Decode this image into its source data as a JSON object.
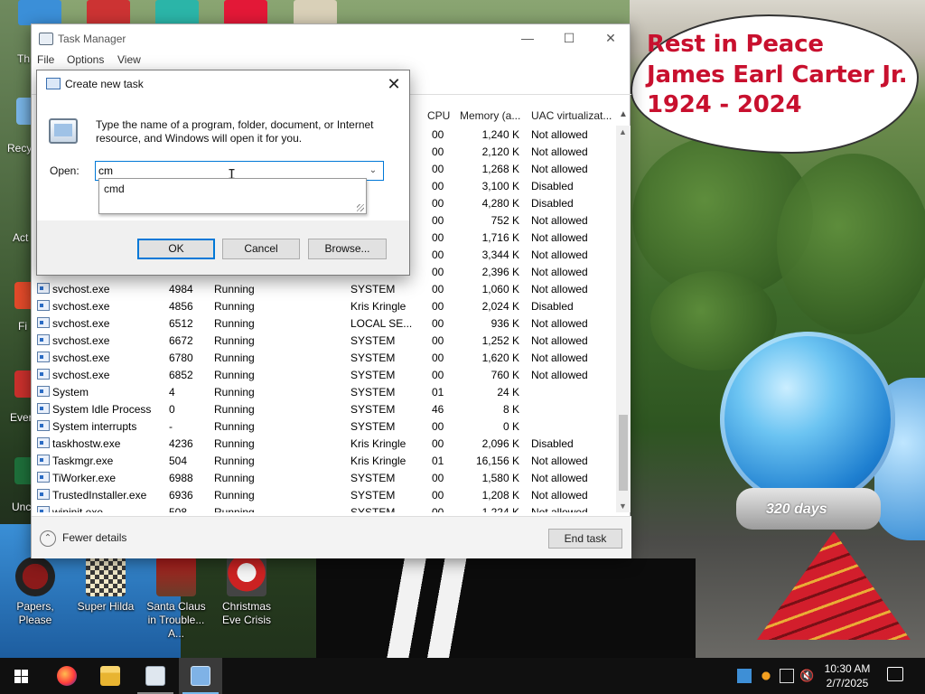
{
  "desktop": {
    "icons": [
      {
        "label": "Papers, Please",
        "name": "desktop-icon-papers-please"
      },
      {
        "label": "Super Hilda",
        "name": "desktop-icon-super-hilda"
      },
      {
        "label": "Santa Claus in Trouble... A...",
        "name": "desktop-icon-santa-claus"
      },
      {
        "label": "Christmas Eve Crisis",
        "name": "desktop-icon-christmas-eve-crisis"
      }
    ],
    "edge_labels": [
      "Th",
      "Recy",
      "Act",
      "Fi",
      "Ever",
      "Unc"
    ],
    "wallpaper_text": [
      "Rest in Peace",
      "James Earl Carter Jr.",
      "1924 - 2024"
    ],
    "globe_text": "320 days"
  },
  "task_manager": {
    "title": "Task Manager",
    "menu": [
      "File",
      "Options",
      "View"
    ],
    "columns": {
      "cpu": "CPU",
      "memory": "Memory (a...",
      "uac": "UAC virtualizat..."
    },
    "rows": [
      {
        "cpu": "00",
        "mem": "1,240 K",
        "uac": "Not allowed"
      },
      {
        "cpu": "00",
        "mem": "2,120 K",
        "uac": "Not allowed"
      },
      {
        "cpu": "00",
        "mem": "1,268 K",
        "uac": "Not allowed"
      },
      {
        "cpu": "00",
        "mem": "3,100 K",
        "uac": "Disabled"
      },
      {
        "cpu": "00",
        "mem": "4,280 K",
        "uac": "Disabled"
      },
      {
        "cpu": "00",
        "mem": "752 K",
        "uac": "Not allowed"
      },
      {
        "cpu": "00",
        "mem": "1,716 K",
        "uac": "Not allowed"
      },
      {
        "cpu": "00",
        "mem": "3,344 K",
        "uac": "Not allowed"
      },
      {
        "cpu": "00",
        "mem": "2,396 K",
        "uac": "Not allowed"
      },
      {
        "name": "svchost.exe",
        "pid": "4984",
        "status": "Running",
        "user": "SYSTEM",
        "cpu": "00",
        "mem": "1,060 K",
        "uac": "Not allowed"
      },
      {
        "name": "svchost.exe",
        "pid": "4856",
        "status": "Running",
        "user": "Kris Kringle",
        "cpu": "00",
        "mem": "2,024 K",
        "uac": "Disabled"
      },
      {
        "name": "svchost.exe",
        "pid": "6512",
        "status": "Running",
        "user": "LOCAL SE...",
        "cpu": "00",
        "mem": "936 K",
        "uac": "Not allowed"
      },
      {
        "name": "svchost.exe",
        "pid": "6672",
        "status": "Running",
        "user": "SYSTEM",
        "cpu": "00",
        "mem": "1,252 K",
        "uac": "Not allowed"
      },
      {
        "name": "svchost.exe",
        "pid": "6780",
        "status": "Running",
        "user": "SYSTEM",
        "cpu": "00",
        "mem": "1,620 K",
        "uac": "Not allowed"
      },
      {
        "name": "svchost.exe",
        "pid": "6852",
        "status": "Running",
        "user": "SYSTEM",
        "cpu": "00",
        "mem": "760 K",
        "uac": "Not allowed"
      },
      {
        "name": "System",
        "pid": "4",
        "status": "Running",
        "user": "SYSTEM",
        "cpu": "01",
        "mem": "24 K",
        "uac": ""
      },
      {
        "name": "System Idle Process",
        "pid": "0",
        "status": "Running",
        "user": "SYSTEM",
        "cpu": "46",
        "mem": "8 K",
        "uac": ""
      },
      {
        "name": "System interrupts",
        "pid": "-",
        "status": "Running",
        "user": "SYSTEM",
        "cpu": "00",
        "mem": "0 K",
        "uac": ""
      },
      {
        "name": "taskhostw.exe",
        "pid": "4236",
        "status": "Running",
        "user": "Kris Kringle",
        "cpu": "00",
        "mem": "2,096 K",
        "uac": "Disabled"
      },
      {
        "name": "Taskmgr.exe",
        "pid": "504",
        "status": "Running",
        "user": "Kris Kringle",
        "cpu": "01",
        "mem": "16,156 K",
        "uac": "Not allowed"
      },
      {
        "name": "TiWorker.exe",
        "pid": "6988",
        "status": "Running",
        "user": "SYSTEM",
        "cpu": "00",
        "mem": "1,580 K",
        "uac": "Not allowed"
      },
      {
        "name": "TrustedInstaller.exe",
        "pid": "6936",
        "status": "Running",
        "user": "SYSTEM",
        "cpu": "00",
        "mem": "1,208 K",
        "uac": "Not allowed"
      },
      {
        "name": "wininit.exe",
        "pid": "508",
        "status": "Running",
        "user": "SYSTEM",
        "cpu": "00",
        "mem": "1,224 K",
        "uac": "Not allowed"
      }
    ],
    "fewer_details": "Fewer details",
    "end_task": "End task"
  },
  "dialog": {
    "title": "Create new task",
    "description": "Type the name of a program, folder, document, or Internet resource, and Windows will open it for you.",
    "open_label": "Open:",
    "open_value": "cm",
    "suggestion": "cmd",
    "ok": "OK",
    "cancel": "Cancel",
    "browse": "Browse..."
  },
  "taskbar": {
    "time": "10:30 AM",
    "date": "2/7/2025"
  },
  "colors": {
    "accent": "#0078d7",
    "taskbar": "#101010",
    "wallpaper_text": "#c8102e"
  }
}
